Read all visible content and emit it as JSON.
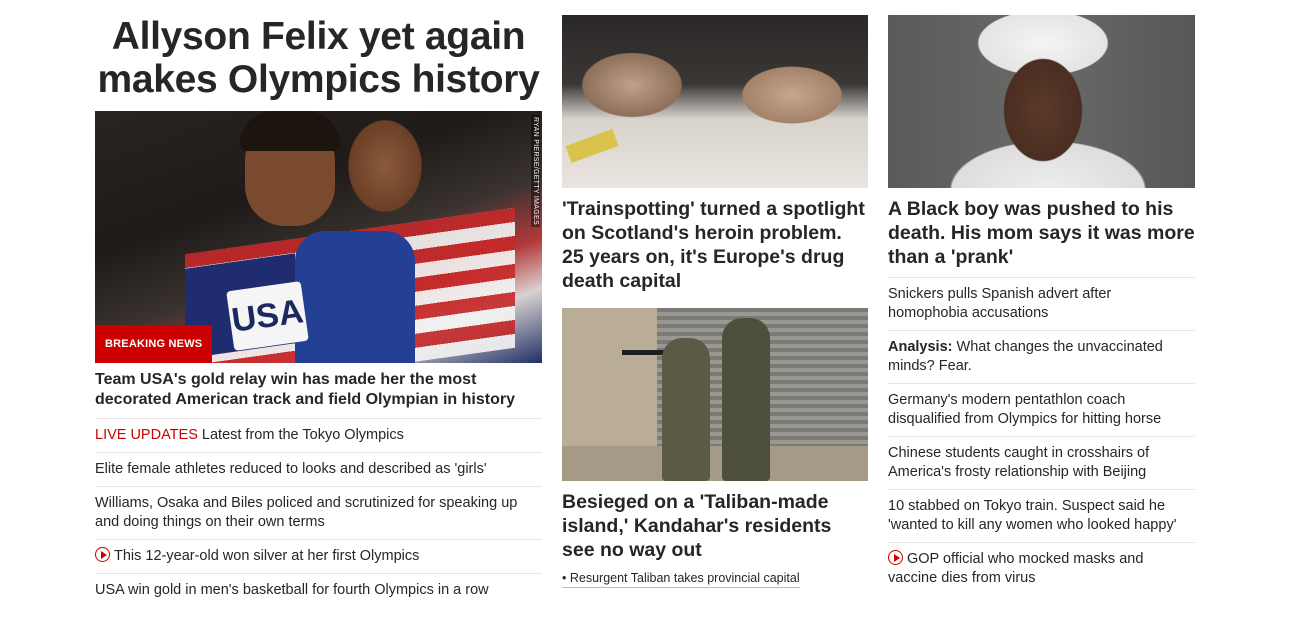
{
  "main": {
    "headline_line1": "Allyson Felix yet again",
    "headline_line2": "makes Olympics history",
    "hero_credit": "RYAN PIERSE/GETTY IMAGES",
    "hero_badge": "BREAKING NEWS",
    "lead_caption": "Team USA's gold relay win has made her the most decorated American track and field Olympian in history",
    "links": [
      {
        "prefix": "LIVE UPDATES",
        "text": "Latest from the Tokyo Olympics"
      },
      {
        "text": "Elite female athletes reduced to looks and described as 'girls'"
      },
      {
        "text": "Williams, Osaka and Biles policed and scrutinized for speaking up and doing things on their own terms"
      },
      {
        "text": "This 12-year-old won silver at her first Olympics",
        "icon": "play-icon"
      },
      {
        "text": "USA win gold in men's basketball for fourth Olympics in a row"
      }
    ]
  },
  "middle": {
    "story1_title": "'Trainspotting' turned a spotlight on Scotland's heroin problem. 25 years on, it's Europe's drug death capital",
    "story2_title": "Besieged on a 'Taliban-made island,' Kandahar's residents see no way out",
    "story2_sub": "• Resurgent Taliban takes provincial capital"
  },
  "right": {
    "story_title": "A Black boy was pushed to his death. His mom says it was more than a 'prank'",
    "links": [
      {
        "text": "Snickers pulls Spanish advert after homophobia accusations"
      },
      {
        "prefix": "Analysis:",
        "text": "What changes the unvaccinated minds? Fear."
      },
      {
        "text": "Germany's modern pentathlon coach disqualified from Olympics for hitting horse"
      },
      {
        "text": "Chinese students caught in crosshairs of America's frosty relationship with Beijing"
      },
      {
        "text": "10 stabbed on Tokyo train. Suspect said he 'wanted to kill any women who looked happy'"
      },
      {
        "text": "GOP official who mocked masks and vaccine dies from virus",
        "icon": "play-icon"
      }
    ]
  },
  "colors": {
    "accent_red": "#cc0000",
    "text": "#262626",
    "divider": "#e6e6e6"
  }
}
